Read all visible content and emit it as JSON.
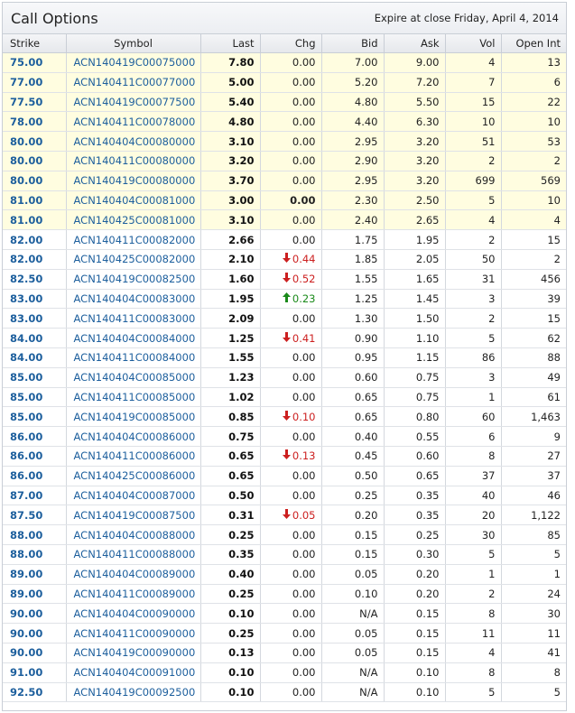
{
  "header": {
    "title": "Call Options",
    "expire_text": "Expire at close Friday, April 4, 2014"
  },
  "columns": [
    "Strike",
    "Symbol",
    "Last",
    "Chg",
    "Bid",
    "Ask",
    "Vol",
    "Open Int"
  ],
  "colors": {
    "link": "#1d5f9d",
    "itm_bg": "#fffde0",
    "down": "#cc1f1f",
    "up": "#1a8a1a"
  },
  "rows": [
    {
      "strike": "75.00",
      "symbol": "ACN140419C00075000",
      "last": "7.80",
      "chg": "0.00",
      "dir": "none",
      "bid": "7.00",
      "ask": "9.00",
      "vol": "4",
      "oi": "13",
      "itm": true
    },
    {
      "strike": "77.00",
      "symbol": "ACN140411C00077000",
      "last": "5.00",
      "chg": "0.00",
      "dir": "none",
      "bid": "5.20",
      "ask": "7.20",
      "vol": "7",
      "oi": "6",
      "itm": true
    },
    {
      "strike": "77.50",
      "symbol": "ACN140419C00077500",
      "last": "5.40",
      "chg": "0.00",
      "dir": "none",
      "bid": "4.80",
      "ask": "5.50",
      "vol": "15",
      "oi": "22",
      "itm": true
    },
    {
      "strike": "78.00",
      "symbol": "ACN140411C00078000",
      "last": "4.80",
      "chg": "0.00",
      "dir": "none",
      "bid": "4.40",
      "ask": "6.30",
      "vol": "10",
      "oi": "10",
      "itm": true
    },
    {
      "strike": "80.00",
      "symbol": "ACN140404C00080000",
      "last": "3.10",
      "chg": "0.00",
      "dir": "none",
      "bid": "2.95",
      "ask": "3.20",
      "vol": "51",
      "oi": "53",
      "itm": true
    },
    {
      "strike": "80.00",
      "symbol": "ACN140411C00080000",
      "last": "3.20",
      "chg": "0.00",
      "dir": "none",
      "bid": "2.90",
      "ask": "3.20",
      "vol": "2",
      "oi": "2",
      "itm": true
    },
    {
      "strike": "80.00",
      "symbol": "ACN140419C00080000",
      "last": "3.70",
      "chg": "0.00",
      "dir": "none",
      "bid": "2.95",
      "ask": "3.20",
      "vol": "699",
      "oi": "569",
      "itm": true
    },
    {
      "strike": "81.00",
      "symbol": "ACN140404C00081000",
      "last": "3.00",
      "chg": "0.00",
      "dir": "bold",
      "bid": "2.30",
      "ask": "2.50",
      "vol": "5",
      "oi": "10",
      "itm": true
    },
    {
      "strike": "81.00",
      "symbol": "ACN140425C00081000",
      "last": "3.10",
      "chg": "0.00",
      "dir": "none",
      "bid": "2.40",
      "ask": "2.65",
      "vol": "4",
      "oi": "4",
      "itm": true
    },
    {
      "strike": "82.00",
      "symbol": "ACN140411C00082000",
      "last": "2.66",
      "chg": "0.00",
      "dir": "none",
      "bid": "1.75",
      "ask": "1.95",
      "vol": "2",
      "oi": "15",
      "itm": false
    },
    {
      "strike": "82.00",
      "symbol": "ACN140425C00082000",
      "last": "2.10",
      "chg": "0.44",
      "dir": "down",
      "bid": "1.85",
      "ask": "2.05",
      "vol": "50",
      "oi": "2",
      "itm": false
    },
    {
      "strike": "82.50",
      "symbol": "ACN140419C00082500",
      "last": "1.60",
      "chg": "0.52",
      "dir": "down",
      "bid": "1.55",
      "ask": "1.65",
      "vol": "31",
      "oi": "456",
      "itm": false
    },
    {
      "strike": "83.00",
      "symbol": "ACN140404C00083000",
      "last": "1.95",
      "chg": "0.23",
      "dir": "up",
      "bid": "1.25",
      "ask": "1.45",
      "vol": "3",
      "oi": "39",
      "itm": false
    },
    {
      "strike": "83.00",
      "symbol": "ACN140411C00083000",
      "last": "2.09",
      "chg": "0.00",
      "dir": "none",
      "bid": "1.30",
      "ask": "1.50",
      "vol": "2",
      "oi": "15",
      "itm": false
    },
    {
      "strike": "84.00",
      "symbol": "ACN140404C00084000",
      "last": "1.25",
      "chg": "0.41",
      "dir": "down",
      "bid": "0.90",
      "ask": "1.10",
      "vol": "5",
      "oi": "62",
      "itm": false
    },
    {
      "strike": "84.00",
      "symbol": "ACN140411C00084000",
      "last": "1.55",
      "chg": "0.00",
      "dir": "none",
      "bid": "0.95",
      "ask": "1.15",
      "vol": "86",
      "oi": "88",
      "itm": false
    },
    {
      "strike": "85.00",
      "symbol": "ACN140404C00085000",
      "last": "1.23",
      "chg": "0.00",
      "dir": "none",
      "bid": "0.60",
      "ask": "0.75",
      "vol": "3",
      "oi": "49",
      "itm": false
    },
    {
      "strike": "85.00",
      "symbol": "ACN140411C00085000",
      "last": "1.02",
      "chg": "0.00",
      "dir": "none",
      "bid": "0.65",
      "ask": "0.75",
      "vol": "1",
      "oi": "61",
      "itm": false
    },
    {
      "strike": "85.00",
      "symbol": "ACN140419C00085000",
      "last": "0.85",
      "chg": "0.10",
      "dir": "down",
      "bid": "0.65",
      "ask": "0.80",
      "vol": "60",
      "oi": "1,463",
      "itm": false
    },
    {
      "strike": "86.00",
      "symbol": "ACN140404C00086000",
      "last": "0.75",
      "chg": "0.00",
      "dir": "none",
      "bid": "0.40",
      "ask": "0.55",
      "vol": "6",
      "oi": "9",
      "itm": false
    },
    {
      "strike": "86.00",
      "symbol": "ACN140411C00086000",
      "last": "0.65",
      "chg": "0.13",
      "dir": "down",
      "bid": "0.45",
      "ask": "0.60",
      "vol": "8",
      "oi": "27",
      "itm": false
    },
    {
      "strike": "86.00",
      "symbol": "ACN140425C00086000",
      "last": "0.65",
      "chg": "0.00",
      "dir": "none",
      "bid": "0.50",
      "ask": "0.65",
      "vol": "37",
      "oi": "37",
      "itm": false
    },
    {
      "strike": "87.00",
      "symbol": "ACN140404C00087000",
      "last": "0.50",
      "chg": "0.00",
      "dir": "none",
      "bid": "0.25",
      "ask": "0.35",
      "vol": "40",
      "oi": "46",
      "itm": false
    },
    {
      "strike": "87.50",
      "symbol": "ACN140419C00087500",
      "last": "0.31",
      "chg": "0.05",
      "dir": "down",
      "bid": "0.20",
      "ask": "0.35",
      "vol": "20",
      "oi": "1,122",
      "itm": false
    },
    {
      "strike": "88.00",
      "symbol": "ACN140404C00088000",
      "last": "0.25",
      "chg": "0.00",
      "dir": "none",
      "bid": "0.15",
      "ask": "0.25",
      "vol": "30",
      "oi": "85",
      "itm": false
    },
    {
      "strike": "88.00",
      "symbol": "ACN140411C00088000",
      "last": "0.35",
      "chg": "0.00",
      "dir": "none",
      "bid": "0.15",
      "ask": "0.30",
      "vol": "5",
      "oi": "5",
      "itm": false
    },
    {
      "strike": "89.00",
      "symbol": "ACN140404C00089000",
      "last": "0.40",
      "chg": "0.00",
      "dir": "none",
      "bid": "0.05",
      "ask": "0.20",
      "vol": "1",
      "oi": "1",
      "itm": false
    },
    {
      "strike": "89.00",
      "symbol": "ACN140411C00089000",
      "last": "0.25",
      "chg": "0.00",
      "dir": "none",
      "bid": "0.10",
      "ask": "0.20",
      "vol": "2",
      "oi": "24",
      "itm": false
    },
    {
      "strike": "90.00",
      "symbol": "ACN140404C00090000",
      "last": "0.10",
      "chg": "0.00",
      "dir": "none",
      "bid": "N/A",
      "ask": "0.15",
      "vol": "8",
      "oi": "30",
      "itm": false
    },
    {
      "strike": "90.00",
      "symbol": "ACN140411C00090000",
      "last": "0.25",
      "chg": "0.00",
      "dir": "none",
      "bid": "0.05",
      "ask": "0.15",
      "vol": "11",
      "oi": "11",
      "itm": false
    },
    {
      "strike": "90.00",
      "symbol": "ACN140419C00090000",
      "last": "0.13",
      "chg": "0.00",
      "dir": "none",
      "bid": "0.05",
      "ask": "0.15",
      "vol": "4",
      "oi": "41",
      "itm": false
    },
    {
      "strike": "91.00",
      "symbol": "ACN140404C00091000",
      "last": "0.10",
      "chg": "0.00",
      "dir": "none",
      "bid": "N/A",
      "ask": "0.10",
      "vol": "8",
      "oi": "8",
      "itm": false
    },
    {
      "strike": "92.50",
      "symbol": "ACN140419C00092500",
      "last": "0.10",
      "chg": "0.00",
      "dir": "none",
      "bid": "N/A",
      "ask": "0.10",
      "vol": "5",
      "oi": "5",
      "itm": false
    }
  ]
}
